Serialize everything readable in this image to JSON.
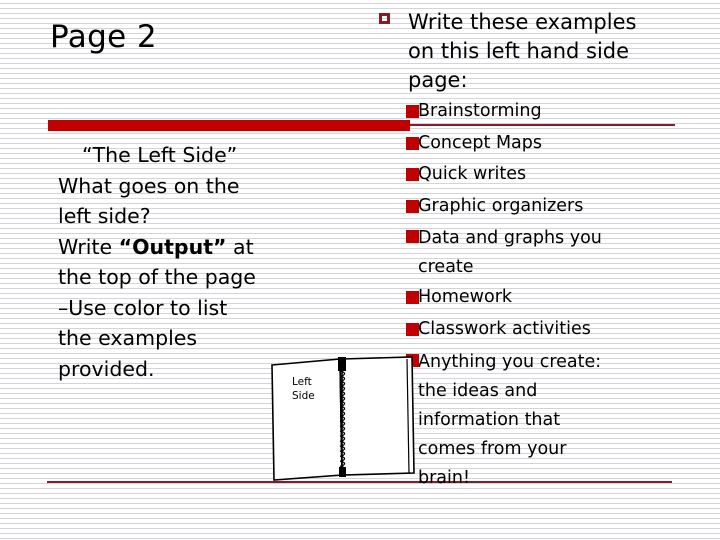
{
  "slide": {
    "title": "Page 2",
    "accent_color": "#c00000",
    "rule_color": "#8b1a24",
    "background": "#ffffff"
  },
  "left_column": {
    "lines": [
      {
        "text": "“The Left Side”",
        "style": "quote"
      },
      {
        "text": "What goes on the",
        "style": "plain"
      },
      {
        "text": "left side?",
        "style": "plain"
      },
      {
        "text": "Write “Output” at",
        "style": "rich",
        "pre": "Write ",
        "bold": "“Output”",
        "post": " at"
      },
      {
        "text": "the top of the page",
        "style": "plain"
      },
      {
        "text": "–Use color to list",
        "style": "plain"
      },
      {
        "text": "the examples",
        "style": "plain"
      },
      {
        "text": "provided.",
        "style": "plain"
      }
    ]
  },
  "right_column": {
    "heading": {
      "bullet_icon": "hollow-square-bullet-icon",
      "lines": [
        "Write these examples",
        "on this left hand side",
        "page:"
      ]
    },
    "items": [
      {
        "bullet_icon": "filled-square-bullet-icon",
        "lines": [
          "Brainstorming"
        ]
      },
      {
        "bullet_icon": "filled-square-bullet-icon",
        "lines": [
          "Concept Maps"
        ]
      },
      {
        "bullet_icon": "filled-square-bullet-icon",
        "lines": [
          "Quick writes"
        ]
      },
      {
        "bullet_icon": "filled-square-bullet-icon",
        "lines": [
          "Graphic organizers"
        ]
      },
      {
        "bullet_icon": "filled-square-bullet-icon",
        "lines": [
          "Data and graphs you",
          "create"
        ]
      },
      {
        "bullet_icon": "filled-square-bullet-icon",
        "lines": [
          "Homework"
        ]
      },
      {
        "bullet_icon": "filled-square-bullet-icon",
        "lines": [
          "Classwork activities"
        ]
      },
      {
        "bullet_icon": "filled-square-bullet-icon",
        "lines": [
          "Anything you create:",
          "the ideas and",
          "information that",
          "comes from your",
          "brain!"
        ]
      }
    ]
  },
  "notebook": {
    "icon": "open-notebook-icon",
    "label_line_1": "Left",
    "label_line_2": "Side"
  }
}
